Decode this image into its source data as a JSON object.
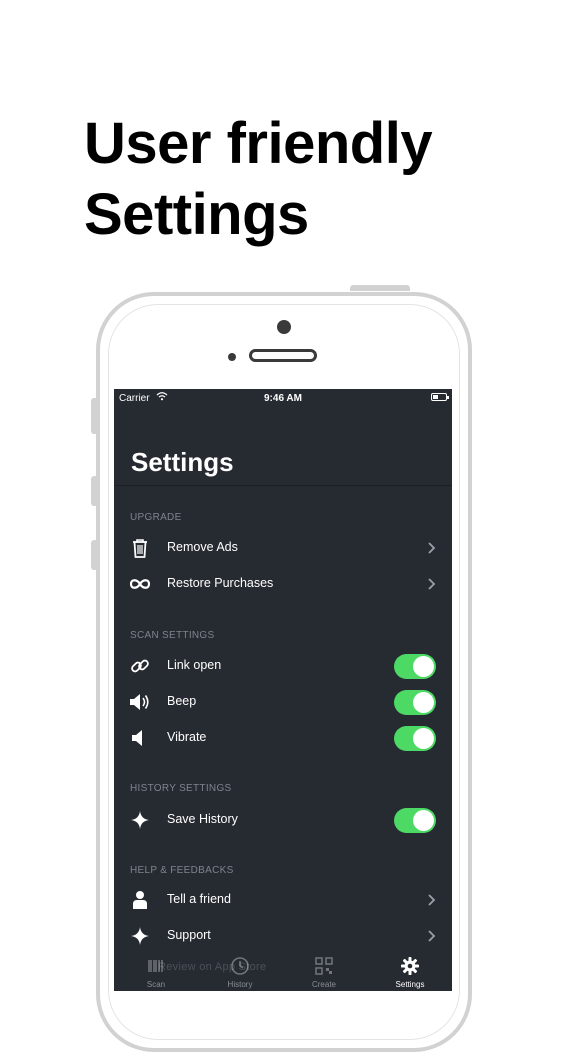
{
  "headline": {
    "line1": "User friendly",
    "line2": "Settings"
  },
  "status_bar": {
    "carrier": "Carrier",
    "time": "9:46 AM"
  },
  "nav": {
    "title": "Settings"
  },
  "sections": {
    "upgrade": {
      "header": "UPGRADE",
      "items": [
        {
          "label": "Remove Ads",
          "icon": "trash-icon",
          "accessory": "chevron"
        },
        {
          "label": "Restore Purchases",
          "icon": "infinity-icon",
          "accessory": "chevron"
        }
      ]
    },
    "scan": {
      "header": "SCAN SETTINGS",
      "items": [
        {
          "label": "Link open",
          "icon": "link-icon",
          "on": true
        },
        {
          "label": "Beep",
          "icon": "speaker-icon",
          "on": true
        },
        {
          "label": "Vibrate",
          "icon": "vibrate-speaker-icon",
          "on": true
        }
      ]
    },
    "history": {
      "header": "HISTORY SETTINGS",
      "items": [
        {
          "label": "Save History",
          "icon": "sparkle-icon",
          "on": true
        }
      ]
    },
    "help": {
      "header": "HELP & FEEDBACKS",
      "items": [
        {
          "label": "Tell a friend",
          "icon": "person-icon",
          "accessory": "chevron"
        },
        {
          "label": "Support",
          "icon": "sparkle-icon",
          "accessory": "chevron"
        }
      ]
    }
  },
  "tab_bar": {
    "ghost_text": "Review on App Store",
    "tabs": [
      {
        "label": "Scan",
        "icon": "barcode-icon",
        "active": false
      },
      {
        "label": "History",
        "icon": "clock-icon",
        "active": false
      },
      {
        "label": "Create",
        "icon": "qr-code-icon",
        "active": false
      },
      {
        "label": "Settings",
        "icon": "gear-icon",
        "active": true
      }
    ]
  },
  "colors": {
    "screen_bg": "#262a31",
    "toggle_on": "#4cd964",
    "section_header": "#7f848c"
  }
}
